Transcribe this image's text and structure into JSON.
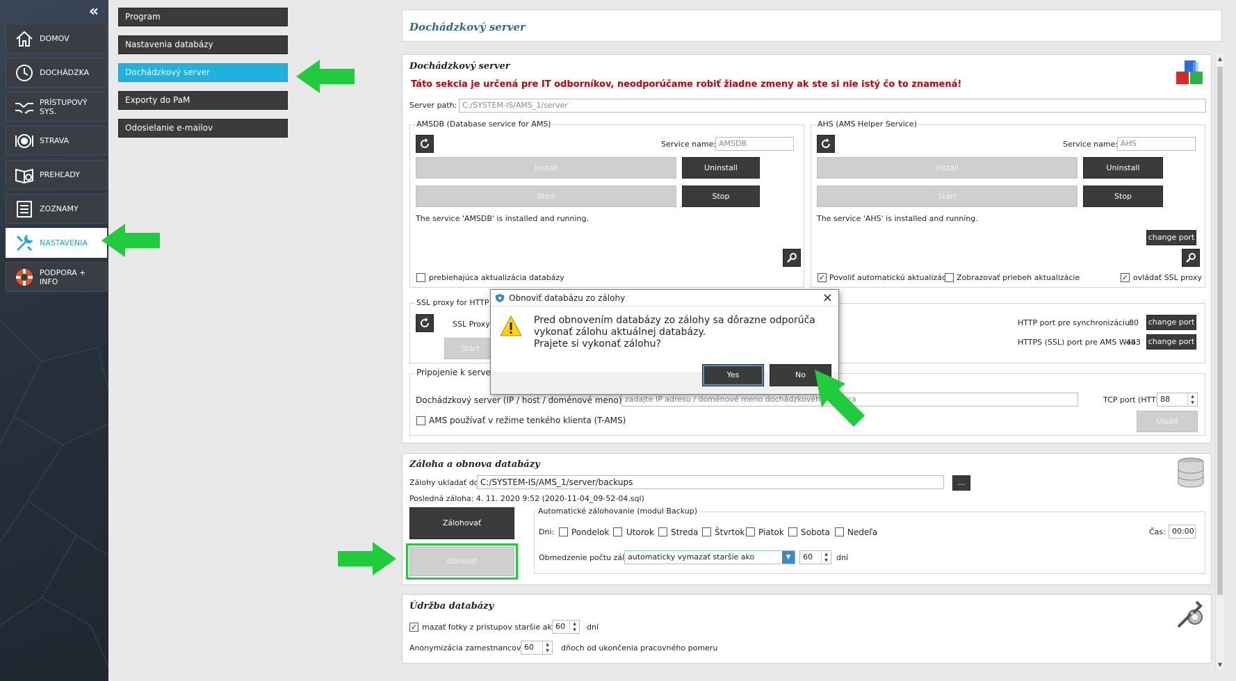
{
  "sidebar": {
    "collapse_glyph": "«",
    "items": [
      {
        "label": "DOMOV",
        "icon": "home-icon"
      },
      {
        "label": "DOCHÁDZKA",
        "icon": "clock-icon"
      },
      {
        "label": "PRÍSTUPOVÝ SYS.",
        "icon": "handshake-icon"
      },
      {
        "label": "STRAVA",
        "icon": "plate-icon"
      },
      {
        "label": "PREHĽADY",
        "icon": "book-icon"
      },
      {
        "label": "ZOZNAMY",
        "icon": "list-icon"
      },
      {
        "label": "NASTAVENIA",
        "icon": "tools-icon",
        "active": true
      },
      {
        "label": "PODPORA + INFO",
        "icon": "lifebuoy-icon"
      }
    ]
  },
  "submenu": {
    "items": [
      "Program",
      "Nastavenia databázy",
      "Dochádzkový server",
      "Exporty do PaM",
      "Odosielanie e-mailov"
    ],
    "active_index": 2
  },
  "header": {
    "title": "Dochádzkový server"
  },
  "server_panel": {
    "title": "Dochádzkový server",
    "warning": "Táto sekcia je určená pre IT odborníkov, neodporúčame robiť žiadne zmeny ak ste si nie istý čo to znamená!",
    "server_path_label": "Server path:",
    "server_path_value": "C:/SYSTEM-IS/AMS_1/server",
    "amsdb": {
      "group_label": "AMSDB (Database service for AMS)",
      "service_name_label": "Service name:",
      "service_name_value": "AMSDB",
      "install": "Install",
      "uninstall": "Uninstall",
      "start": "Start",
      "stop": "Stop",
      "status": "The service 'AMSDB' is installed and running.",
      "checkbox_label": "prebiehajúca aktualizácia databázy"
    },
    "ahs": {
      "group_label": "AHS (AMS Helper Service)",
      "service_name_label": "Service name:",
      "service_name_value": "AHS",
      "install": "Install",
      "uninstall": "Uninstall",
      "start": "Start",
      "stop": "Stop",
      "status": "The service 'AHS' is installed and running.",
      "change_port": "change port",
      "cb_auto_update": "Povoliť automatickú aktualizáciu",
      "cb_show_progress": "Zobrazovať priebeh aktualizácie",
      "cb_ssl_proxy": "ovládať SSL proxy"
    },
    "ssl": {
      "group_label": "SSL proxy for HTTP se",
      "proxy_label": "SSL Proxy (",
      "start": "Start",
      "http_port_label": "HTTP port pre synchronizáciu:",
      "http_port_value": "80",
      "https_port_label": "HTTPS (SSL) port pre AMS Web:",
      "https_port_value": "443",
      "change_port": "change port"
    },
    "connect": {
      "group_label": "Pripojenie k server",
      "server_label": "Dochádzkový server (IP / host / doménové meno):",
      "server_placeholder": "zadajte IP adresu / doménové meno dochádzkového servera",
      "tcp_label": "TCP port (HTTP):",
      "tcp_value": "88",
      "thin_client_label": "AMS používať v režime tenkého klienta (T-AMS)",
      "save": "Uložiť"
    }
  },
  "backup_panel": {
    "title": "Záloha a obnova databázy",
    "save_to_label": "Zálohy ukladať do:",
    "save_to_value": "C:/SYSTEM-IS/AMS_1/server/backups",
    "browse": "...",
    "last_backup": "Posledná záloha:  4. 11. 2020 9:52 (2020-11-04_09-52-04.sql)",
    "backup_button": "Zálohovať",
    "restore_button": "Obnoviť",
    "auto_group_label": "Automatické zálohovanie (modul Backup)",
    "days_label": "Dni:",
    "days": [
      "Pondelok",
      "Utorok",
      "Streda",
      "Štvrtok",
      "Piatok",
      "Sobota",
      "Nedeľa"
    ],
    "time_label": "Čas:",
    "time_value": "00:00",
    "limit_label": "Obmedzenie počtu záloh:",
    "limit_option": "automaticky vymazať staršie ako",
    "limit_value": "60",
    "limit_unit": "dní"
  },
  "maint_panel": {
    "title": "Údržba databázy",
    "photos_label": "mazať fotky z prístupov staršie ako:",
    "photos_value": "60",
    "photos_unit": "dní",
    "anon_label": "Anonymizácia zamestnancov po",
    "anon_value": "60",
    "anon_unit": "dňoch od ukončenia pracovného pomeru"
  },
  "dialog": {
    "title": "Obnoviť databázu zo zálohy",
    "message_line1": "Pred obnovením databázy zo zálohy sa dôrazne odporúča",
    "message_line2": "vykonať zálohu aktuálnej databázy.",
    "message_line3": "Prajete si vykonať zálohu?",
    "yes": "Yes",
    "no": "No"
  },
  "colors": {
    "accent": "#1fb1e0",
    "warning": "#cc0000",
    "arrow": "#1fcc3c",
    "button_dark": "#3b3b3b"
  }
}
